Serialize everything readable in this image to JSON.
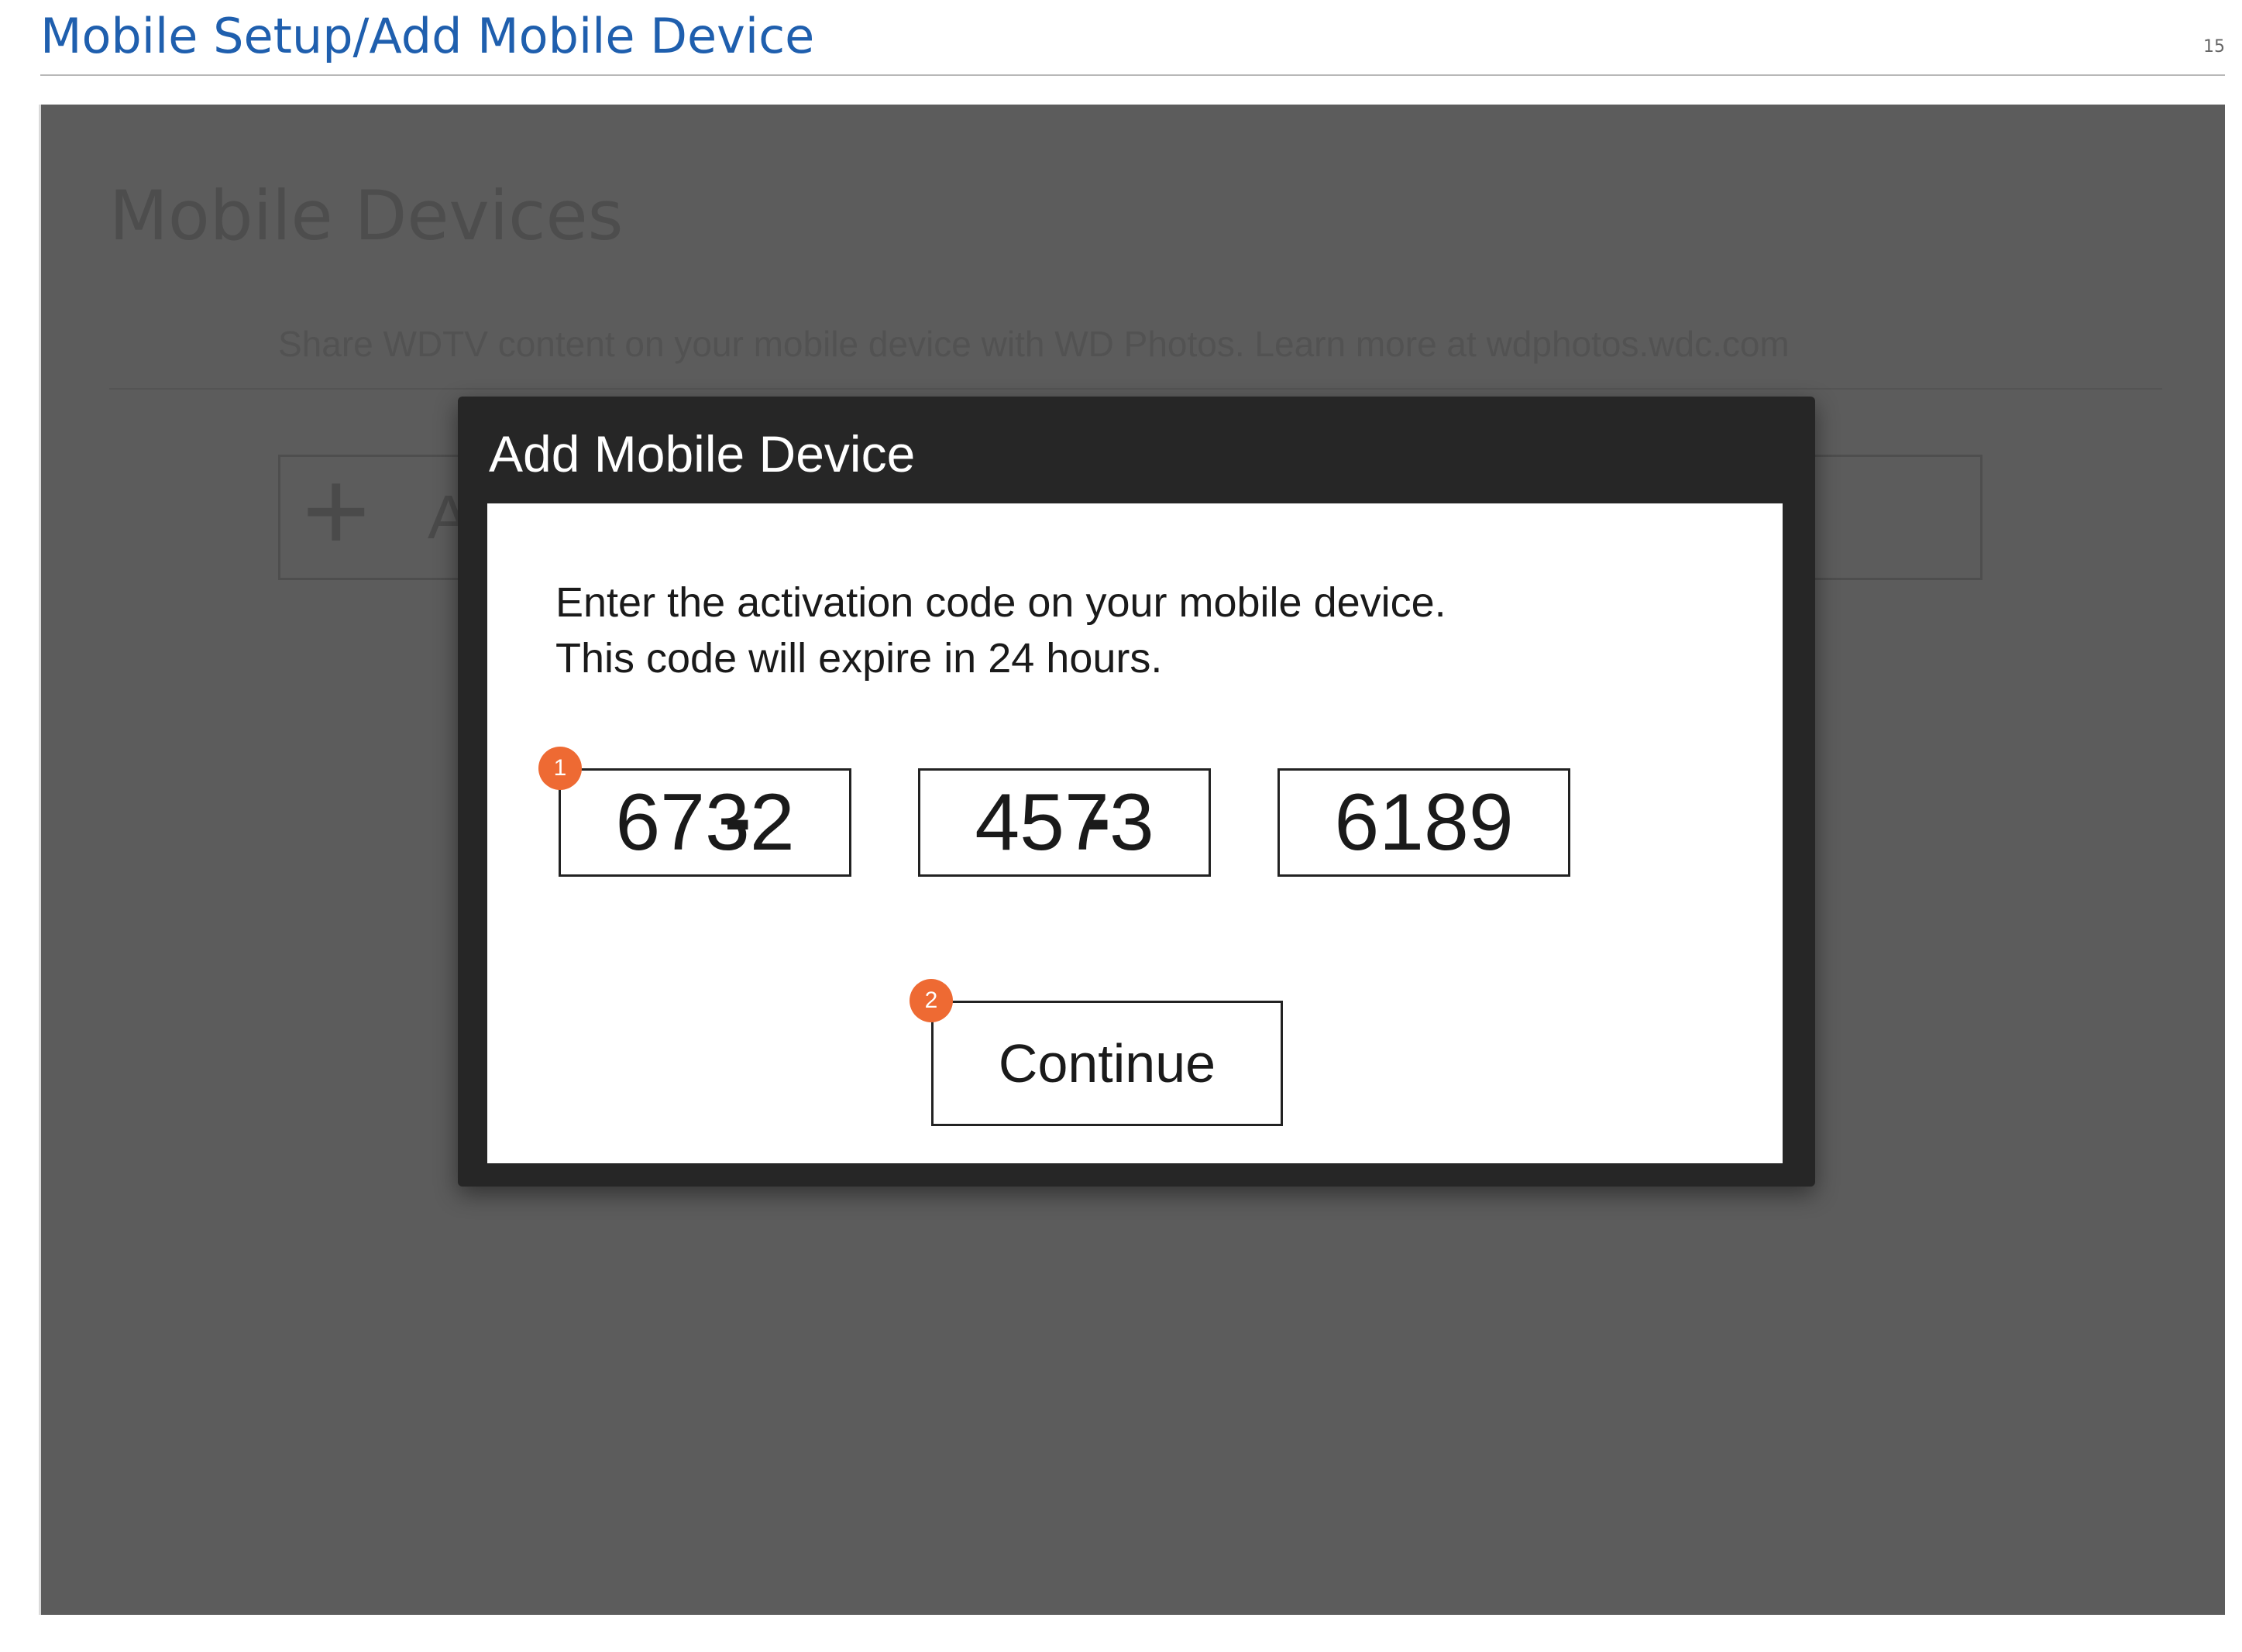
{
  "page": {
    "title": "Mobile Setup/Add Mobile Device",
    "number": "15"
  },
  "background": {
    "title": "Mobile Devices",
    "description": "Share WDTV content on your mobile device with WD Photos. Learn more at wdphotos.wdc.com",
    "add_icon": "+",
    "add_label": "A"
  },
  "dialog": {
    "title": "Add Mobile Device",
    "instruction_line1": "Enter the activation code on your mobile device.",
    "instruction_line2": "This code will expire in 24 hours.",
    "code": [
      "6732",
      "4573",
      "6189"
    ],
    "separator": "-",
    "continue_label": "Continue"
  },
  "callouts": [
    "1",
    "2"
  ],
  "colors": {
    "title_blue": "#1f5fae",
    "overlay_gray": "#5c5c5c",
    "dialog_dark": "#262626",
    "callout_orange": "#ee6a33"
  }
}
